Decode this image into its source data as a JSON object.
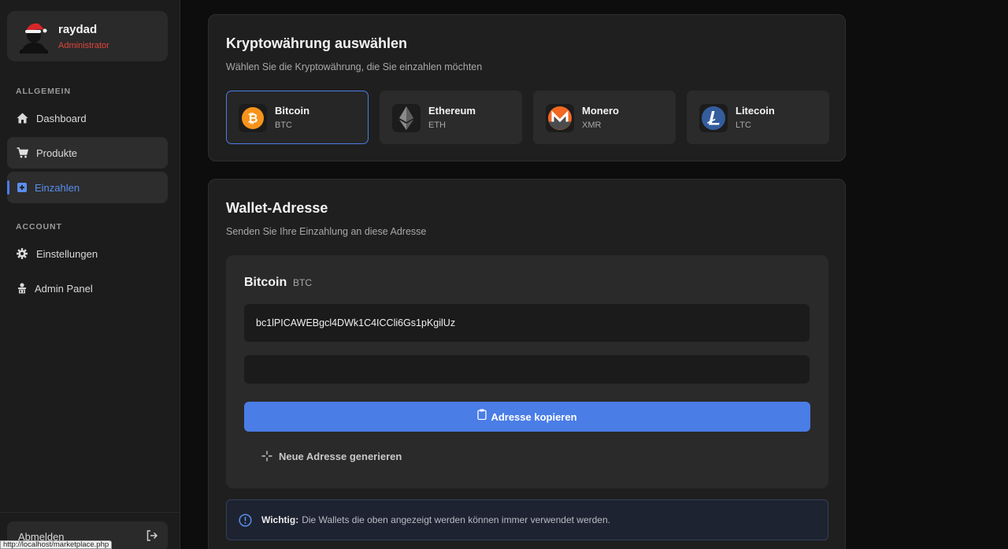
{
  "user": {
    "name": "raydad",
    "role": "Administrator"
  },
  "sidebar": {
    "section_general": "ALLGEMEIN",
    "section_account": "ACCOUNT",
    "items": [
      {
        "label": "Dashboard",
        "icon": "home-icon"
      },
      {
        "label": "Produkte",
        "icon": "cart-icon"
      },
      {
        "label": "Einzahlen",
        "icon": "plus-square-icon"
      },
      {
        "label": "Einstellungen",
        "icon": "gear-icon"
      },
      {
        "label": "Admin Panel",
        "icon": "admin-icon"
      }
    ],
    "logout_label": "Abmelden",
    "status_url": "http://localhost/marketplace.php"
  },
  "select_crypto": {
    "title": "Kryptowährung auswählen",
    "subtitle": "Wählen Sie die Kryptowährung, die Sie einzahlen möchten",
    "options": [
      {
        "name": "Bitcoin",
        "symbol": "BTC",
        "color": "#f7931a",
        "selected": true
      },
      {
        "name": "Ethereum",
        "symbol": "ETH",
        "color": "#8a8a8a",
        "selected": false
      },
      {
        "name": "Monero",
        "symbol": "XMR",
        "color": "#f26822",
        "selected": false
      },
      {
        "name": "Litecoin",
        "symbol": "LTC",
        "color": "#345d9d",
        "selected": false
      }
    ]
  },
  "wallet": {
    "title": "Wallet-Adresse",
    "subtitle": "Senden Sie Ihre Einzahlung an diese Adresse",
    "coin_name": "Bitcoin",
    "coin_symbol": "BTC",
    "address": "bc1lPICAWEBgcl4DWk1C4ICCli6Gs1pKgilUz",
    "copy_label": "Adresse kopieren",
    "generate_label": "Neue Adresse generieren",
    "notice_bold": "Wichtig:",
    "notice_text": "Die Wallets die oben angezeigt werden können immer verwendet werden."
  },
  "colors": {
    "accent": "#4a7de6",
    "role": "#e0453a",
    "background": "#0d0d0d"
  }
}
